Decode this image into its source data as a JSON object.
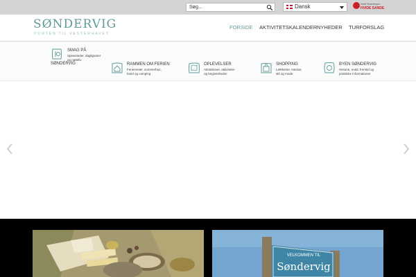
{
  "topbar": {
    "search_placeholder": "Søg...",
    "search_icon": "magnifier-icon",
    "language": "Dansk",
    "language_flag": "danish-flag-icon",
    "partner_line1": "Hotel Strandvejen",
    "partner_line2": "HVIDE SANDE"
  },
  "header": {
    "logo_word": "SØNDERVIG",
    "logo_tag": "PORTEN TIL VESTERHAVET",
    "nav": [
      "FORSIDE",
      "AKTIVITETSKALENDER",
      "NYHEDER",
      "TURFORSLAG"
    ],
    "active_nav": "FORSIDE"
  },
  "subnav": [
    {
      "title": "SMAG PÅ",
      "title2": "SØNDERVIG",
      "desc": [
        "Spisesteder, dagligvarer",
        "og natteliv"
      ],
      "icon": "fork-knife-icon"
    },
    {
      "title": "RAMMEN OM FERIEN",
      "desc": [
        "Feriecenter, sommerhus,",
        "hotel og camping"
      ],
      "icon": "house-icon"
    },
    {
      "title": "OPLEVELSER",
      "desc": [
        "Attraktioner, aktiviteter",
        "og begivenheder"
      ],
      "icon": "map-icon"
    },
    {
      "title": "SHOPPING",
      "desc": [
        "Lækkerier, Interiør,",
        "stil og mode"
      ],
      "icon": "shopping-bag-icon"
    },
    {
      "title": "BYEN SØNDERVIG",
      "desc": [
        "Historie, nutid, fremtid og",
        "praktiske informationer"
      ],
      "icon": "info-bubble-icon"
    }
  ],
  "slider": {
    "prev_icon": "chevron-left-icon",
    "next_icon": "chevron-right-icon"
  },
  "cards": [
    {
      "image": "cheese-platter-photo"
    },
    {
      "image": "welcome-sign-photo",
      "sign_line1": "VELKOMMEN TIL",
      "sign_line2": "Søndervig"
    }
  ],
  "colors": {
    "brand": "#5f9a98",
    "topbar": "#d4d4d4",
    "partner_red": "#cc1f2a"
  }
}
